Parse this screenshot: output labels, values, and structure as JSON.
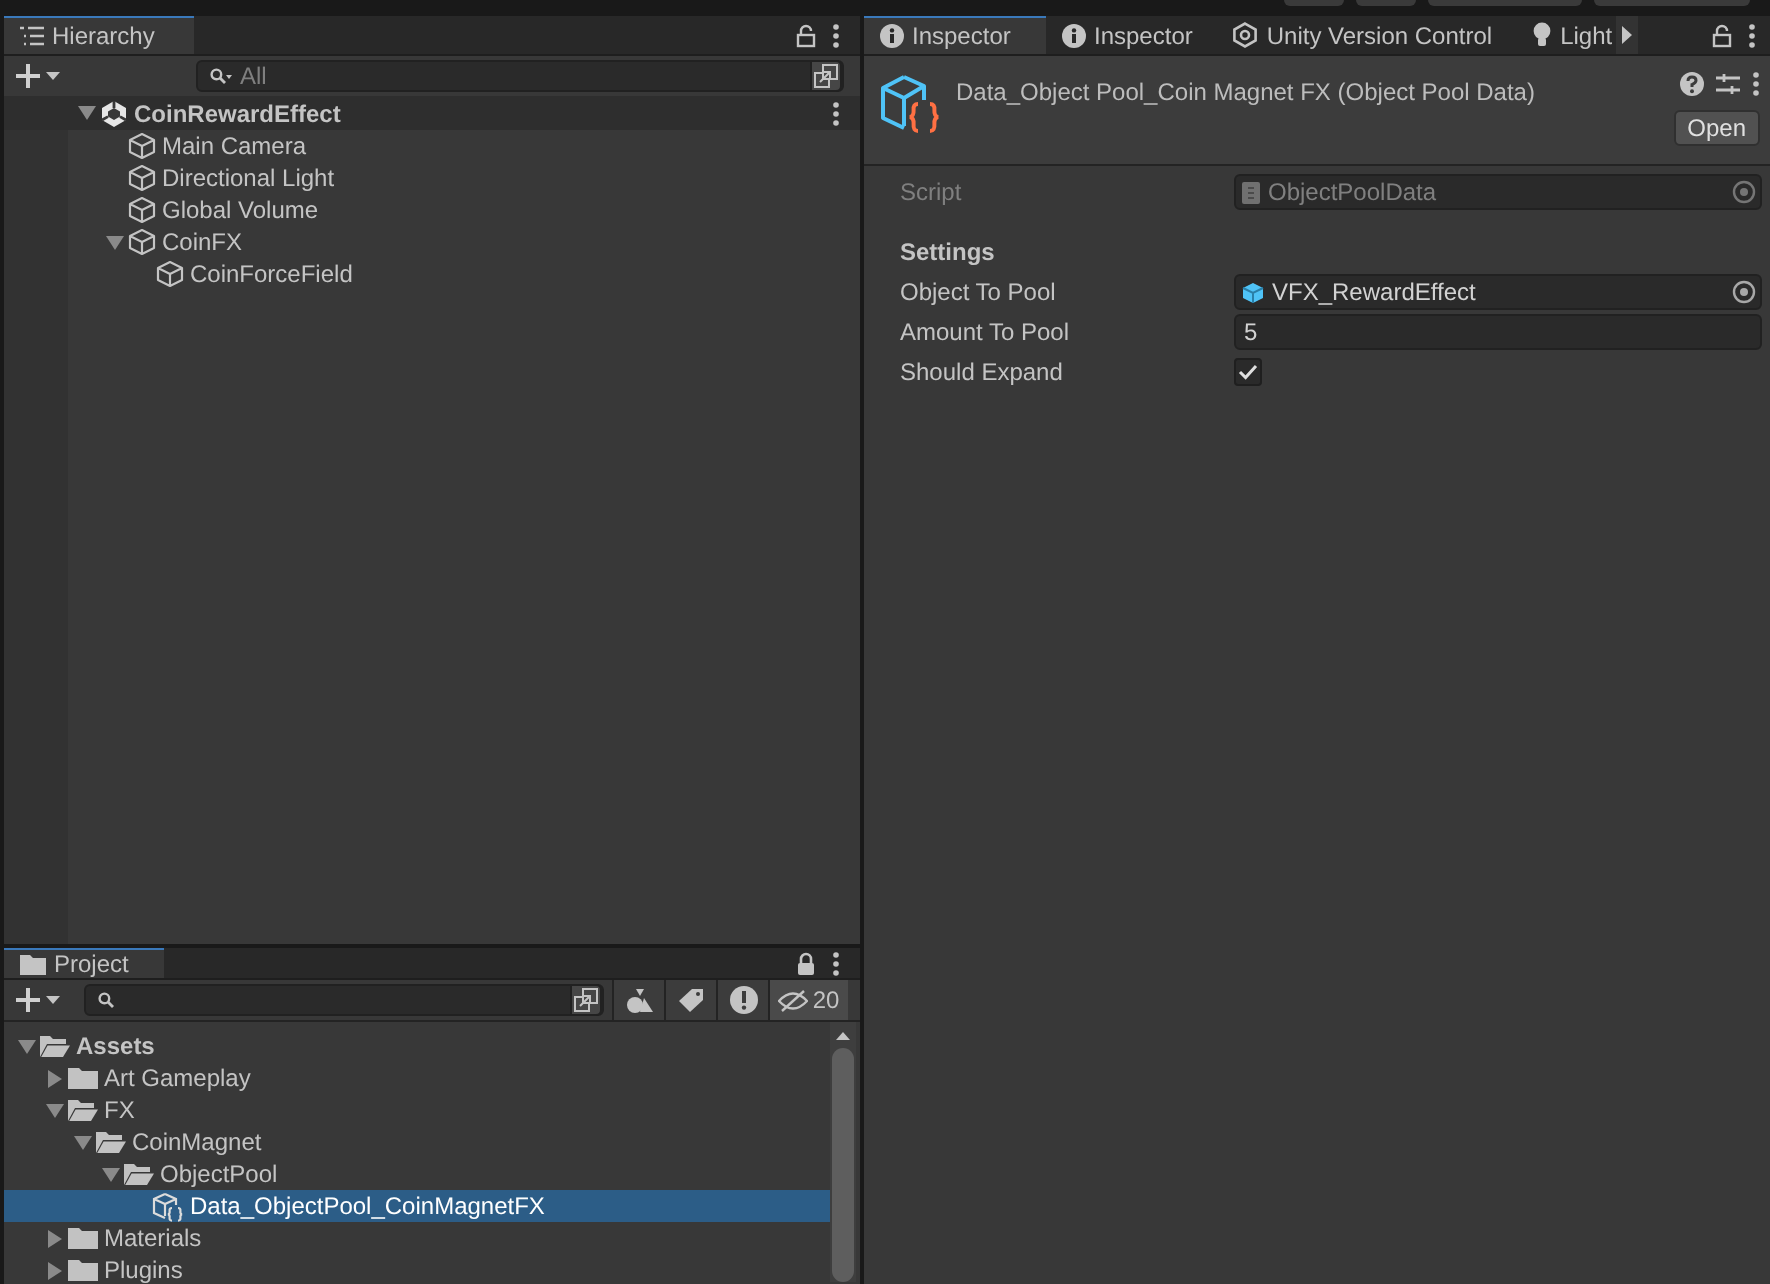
{
  "hierarchy": {
    "tab": "Hierarchy",
    "search": {
      "placeholder": "All"
    },
    "items": [
      {
        "label": "CoinRewardEffect",
        "kind": "scene",
        "expanded": true,
        "children": [
          {
            "label": "Main Camera",
            "kind": "object"
          },
          {
            "label": "Directional Light",
            "kind": "object"
          },
          {
            "label": "Global Volume",
            "kind": "object"
          },
          {
            "label": "CoinFX",
            "kind": "object",
            "expanded": true,
            "children": [
              {
                "label": "CoinForceField",
                "kind": "object"
              }
            ]
          }
        ]
      }
    ]
  },
  "project": {
    "tab": "Project",
    "hidden_count": "20",
    "items": [
      {
        "label": "Assets",
        "kind": "folder",
        "expanded": true,
        "selected": false,
        "children": [
          {
            "label": "Art Gameplay",
            "kind": "folder",
            "expanded": false,
            "selected": false
          },
          {
            "label": "FX",
            "kind": "folder",
            "expanded": true,
            "selected": false,
            "children": [
              {
                "label": "CoinMagnet",
                "kind": "folder",
                "expanded": true,
                "selected": false,
                "children": [
                  {
                    "label": "ObjectPool",
                    "kind": "folder",
                    "expanded": true,
                    "selected": false,
                    "children": [
                      {
                        "label": "Data_ObjectPool_CoinMagnetFX",
                        "kind": "asset",
                        "selected": true
                      }
                    ]
                  }
                ]
              }
            ]
          },
          {
            "label": "Materials",
            "kind": "folder",
            "expanded": false,
            "selected": false
          },
          {
            "label": "Plugins",
            "kind": "folder",
            "expanded": false,
            "selected": false
          }
        ]
      }
    ]
  },
  "inspector": {
    "tabs": [
      {
        "label": "Inspector",
        "kind": "info",
        "selected": true
      },
      {
        "label": "Inspector",
        "kind": "info",
        "selected": false
      },
      {
        "label": "Unity Version Control",
        "kind": "vcs",
        "selected": false
      },
      {
        "label": "Light",
        "kind": "light",
        "selected": false
      }
    ],
    "title": "Data_Object Pool_Coin Magnet FX (Object Pool Data)",
    "open_button": "Open",
    "fields": [
      {
        "label": "Script",
        "kind": "script",
        "value": "ObjectPoolData"
      },
      {
        "label": "Settings",
        "kind": "header"
      },
      {
        "label": "Object To Pool",
        "kind": "object",
        "value": "VFX_RewardEffect"
      },
      {
        "label": "Amount To Pool",
        "kind": "number",
        "value": "5"
      },
      {
        "label": "Should Expand",
        "kind": "checkbox",
        "checked": true
      }
    ]
  }
}
